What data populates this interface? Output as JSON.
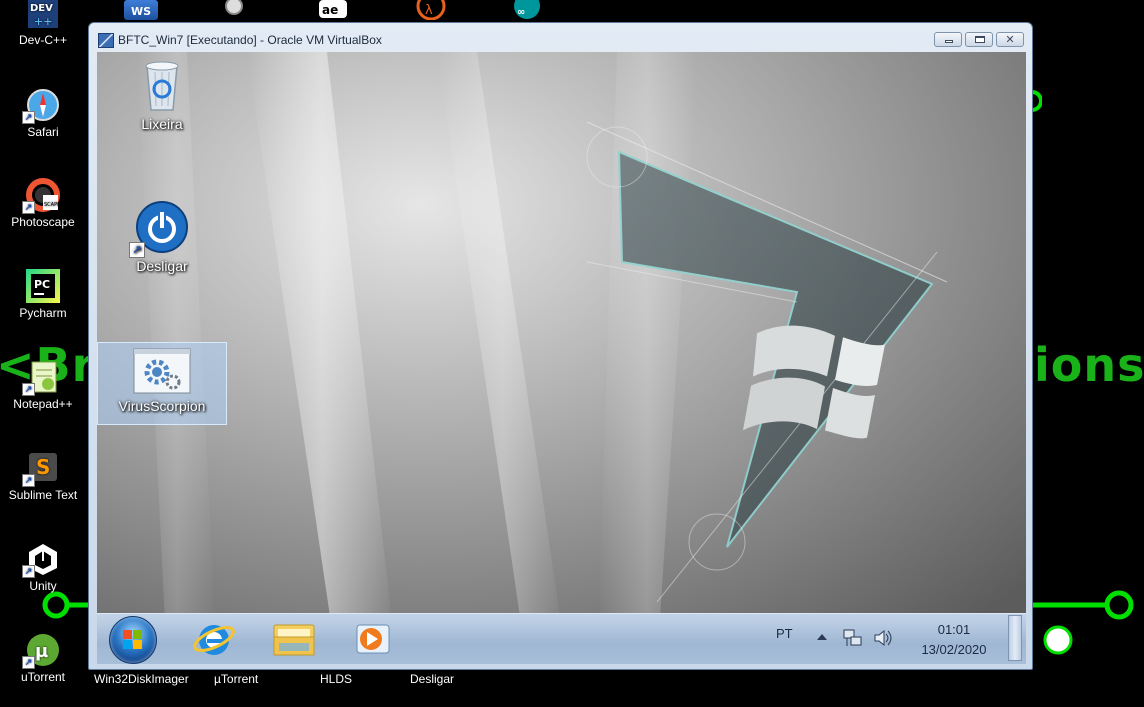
{
  "host": {
    "bg_text_left": "<Br",
    "bg_text_right": "ions>",
    "icons": [
      {
        "label": "Dev-C++",
        "icon": "devcpp-icon"
      },
      {
        "label": "Safari",
        "icon": "safari-icon"
      },
      {
        "label": "Photoscape",
        "icon": "photoscape-icon"
      },
      {
        "label": "Pycharm",
        "icon": "pycharm-icon"
      },
      {
        "label": "Notepad++",
        "icon": "notepadpp-icon"
      },
      {
        "label": "Sublime Text",
        "icon": "sublime-icon"
      },
      {
        "label": "Unity",
        "icon": "unity-icon"
      },
      {
        "label": "uTorrent",
        "icon": "utorrent-icon"
      }
    ],
    "bottom_labels": [
      {
        "label": "Win32DiskImager"
      },
      {
        "label": "µTorrent"
      },
      {
        "label": "HLDS"
      },
      {
        "label": "Desligar"
      }
    ],
    "colors": {
      "circuit_green": "#00e000",
      "bg_text_green": "#19b319"
    }
  },
  "vbox": {
    "title": "BFTC_Win7 [Executando] - Oracle VM VirtualBox",
    "controls": {
      "close_glyph": "✕"
    }
  },
  "guest": {
    "desktop_icons": [
      {
        "label": "Lixeira",
        "icon": "recycle-bin-icon"
      },
      {
        "label": "Desligar",
        "icon": "power-icon"
      },
      {
        "label": "VirusScorpion",
        "icon": "gear-app-icon",
        "selected": true
      }
    ],
    "taskbar": {
      "pinned": [
        {
          "name": "internet-explorer-icon"
        },
        {
          "name": "windows-explorer-icon"
        },
        {
          "name": "media-player-icon"
        }
      ],
      "language": "PT",
      "time": "01:01",
      "date": "13/02/2020"
    }
  }
}
